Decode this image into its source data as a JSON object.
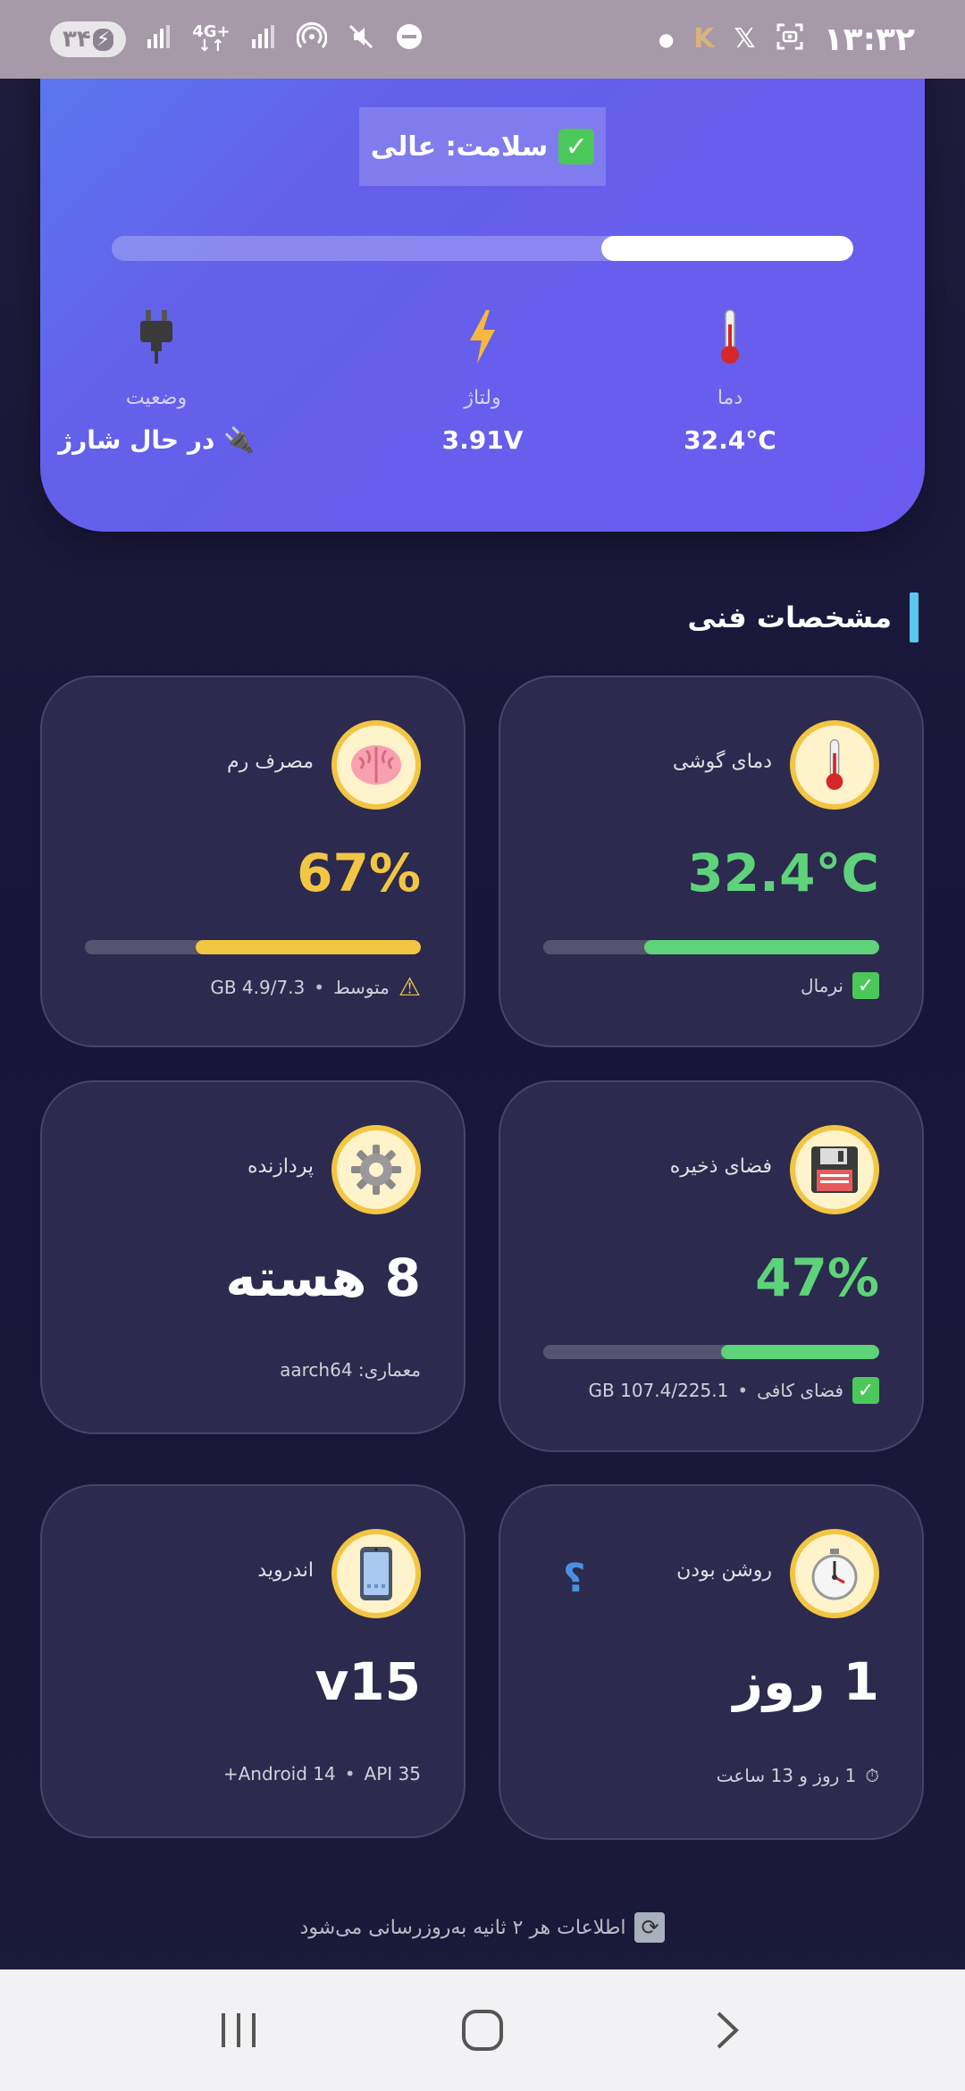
{
  "status_bar": {
    "time": "۱۳:۳۲",
    "battery": "۳۴",
    "network": "4G+"
  },
  "health": {
    "label": "سلامت: عالی",
    "progress_percent": 34,
    "stats": [
      {
        "icon": "plug-icon",
        "label": "وضعیت",
        "value": "🔌 در حال شارژ"
      },
      {
        "icon": "bolt-icon",
        "label": "ولتاژ",
        "value": "3.91V"
      },
      {
        "icon": "thermometer-icon",
        "label": "دما",
        "value": "32.4°C"
      }
    ]
  },
  "section": {
    "title": "مشخصات فنی"
  },
  "cards": {
    "temp": {
      "title": "دمای گوشی",
      "value": "32.4°C",
      "percent": 70,
      "status": "نرمال",
      "color": "#5ed37a"
    },
    "ram": {
      "title": "مصرف رم",
      "value": "67%",
      "percent": 67,
      "status": "متوسط",
      "detail": "GB 4.9/7.3",
      "color": "#f2c642"
    },
    "storage": {
      "title": "فضای ذخیره",
      "value": "47%",
      "percent": 47,
      "status": "فضای کافی",
      "detail": "GB 107.4/225.1",
      "color": "#5ed37a"
    },
    "cpu": {
      "title": "پردازنده",
      "value": "8 هسته",
      "detail": "معماری: aarch64"
    },
    "uptime": {
      "title": "روشن بودن",
      "value": "1 روز",
      "detail": "1 روز و 13 ساعت",
      "extra": "؟"
    },
    "android": {
      "title": "اندروید",
      "value": "v15",
      "detail_a": "API 35",
      "detail_b": "Android 14+"
    }
  },
  "footer": {
    "text": "اطلاعات هر ۲ ثانیه به‌روزرسانی می‌شود"
  }
}
